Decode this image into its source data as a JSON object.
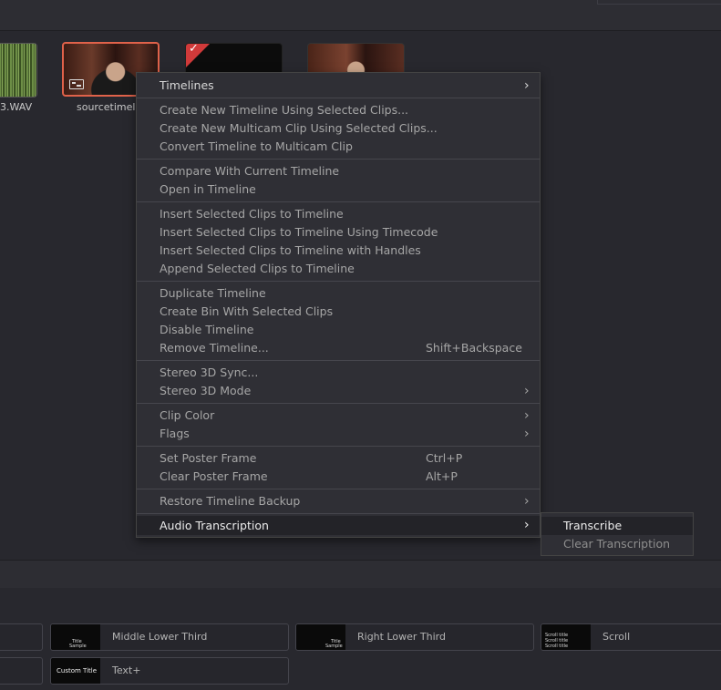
{
  "media_pool": {
    "clips": [
      {
        "label": "3.WAV"
      },
      {
        "label": "sourcetimeli"
      },
      {
        "label": ""
      },
      {
        "label": ""
      }
    ]
  },
  "context_menu": {
    "timelines": "Timelines",
    "create_new_timeline": "Create New Timeline Using Selected Clips...",
    "create_new_multicam": "Create New Multicam Clip Using Selected Clips...",
    "convert_to_multicam": "Convert Timeline to Multicam Clip",
    "compare_with_current": "Compare With Current Timeline",
    "open_in_timeline": "Open in Timeline",
    "insert_selected": "Insert Selected Clips to Timeline",
    "insert_using_timecode": "Insert Selected Clips to Timeline Using Timecode",
    "insert_with_handles": "Insert Selected Clips to Timeline with Handles",
    "append_selected": "Append Selected Clips to Timeline",
    "duplicate_timeline": "Duplicate Timeline",
    "create_bin": "Create Bin With Selected Clips",
    "disable_timeline": "Disable Timeline",
    "remove_timeline": "Remove Timeline...",
    "remove_timeline_shortcut": "Shift+Backspace",
    "stereo_sync": "Stereo 3D Sync...",
    "stereo_mode": "Stereo 3D Mode",
    "clip_color": "Clip Color",
    "flags": "Flags",
    "set_poster": "Set Poster Frame",
    "set_poster_shortcut": "Ctrl+P",
    "clear_poster": "Clear Poster Frame",
    "clear_poster_shortcut": "Alt+P",
    "restore_backup": "Restore Timeline Backup",
    "audio_transcription": "Audio Transcription",
    "arrow": "›"
  },
  "submenu": {
    "transcribe": "Transcribe",
    "clear_transcription": "Clear Transcription"
  },
  "effects": {
    "middle_lower_third": "Middle Lower Third",
    "right_lower_third": "Right Lower Third",
    "scroll": "Scroll",
    "text_plus": "Text+",
    "custom_title_thumb": "Custom Title",
    "sample_thumb_top": "Title",
    "sample_thumb_bottom": "Sample",
    "scroll_thumb_line": "Scroll title"
  }
}
